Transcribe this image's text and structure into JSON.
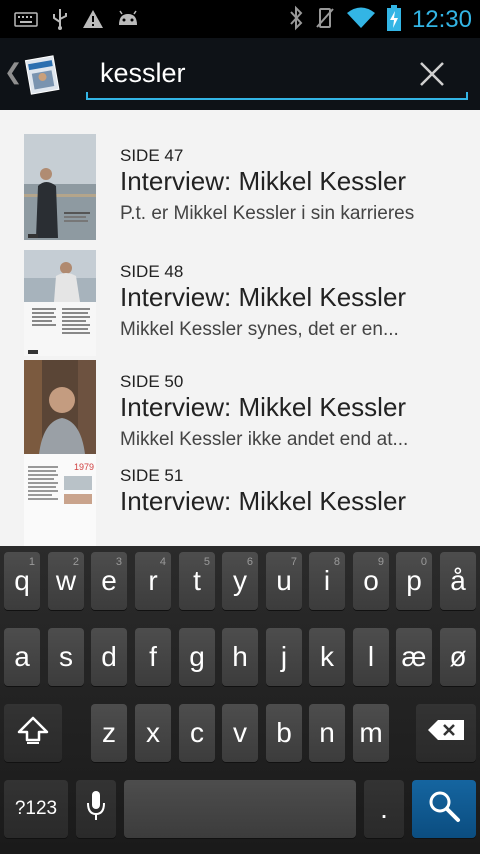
{
  "status_bar": {
    "icons_left": [
      "keyboard-icon",
      "usb-icon",
      "warning-icon",
      "android-icon"
    ],
    "icons_right": [
      "bluetooth-icon",
      "vibrate-off-icon",
      "wifi-icon",
      "battery-charging-icon"
    ],
    "time": "12:30",
    "accent": "#33b5e5"
  },
  "action_bar": {
    "search_value": "kessler",
    "clear_icon": "close-icon"
  },
  "results": [
    {
      "page": "SIDE 47",
      "title": "Interview: Mikkel Kessler",
      "snippet": "P.t. er Mikkel Kessler i sin karrieres"
    },
    {
      "page": "SIDE 48",
      "title": "Interview: Mikkel Kessler",
      "snippet": "Mikkel Kessler synes, det er en..."
    },
    {
      "page": "SIDE 50",
      "title": "Interview: Mikkel Kessler",
      "snippet": "Mikkel Kessler ikke andet end at..."
    },
    {
      "page": "SIDE 51",
      "title": "Interview: Mikkel Kessler",
      "snippet": ""
    }
  ],
  "keyboard": {
    "row1": [
      {
        "label": "q",
        "hint": "1"
      },
      {
        "label": "w",
        "hint": "2"
      },
      {
        "label": "e",
        "hint": "3"
      },
      {
        "label": "r",
        "hint": "4"
      },
      {
        "label": "t",
        "hint": "5"
      },
      {
        "label": "y",
        "hint": "6"
      },
      {
        "label": "u",
        "hint": "7"
      },
      {
        "label": "i",
        "hint": "8"
      },
      {
        "label": "o",
        "hint": "9"
      },
      {
        "label": "p",
        "hint": "0"
      },
      {
        "label": "å",
        "hint": ""
      }
    ],
    "row2": [
      "a",
      "s",
      "d",
      "f",
      "g",
      "h",
      "j",
      "k",
      "l",
      "æ",
      "ø"
    ],
    "row3": [
      "z",
      "x",
      "c",
      "v",
      "b",
      "n",
      "m"
    ],
    "symbols_label": "?123",
    "period_label": ".",
    "shift_icon": "shift-icon",
    "backspace_icon": "backspace-icon",
    "mic_icon": "microphone-icon",
    "search_icon": "search-icon"
  }
}
